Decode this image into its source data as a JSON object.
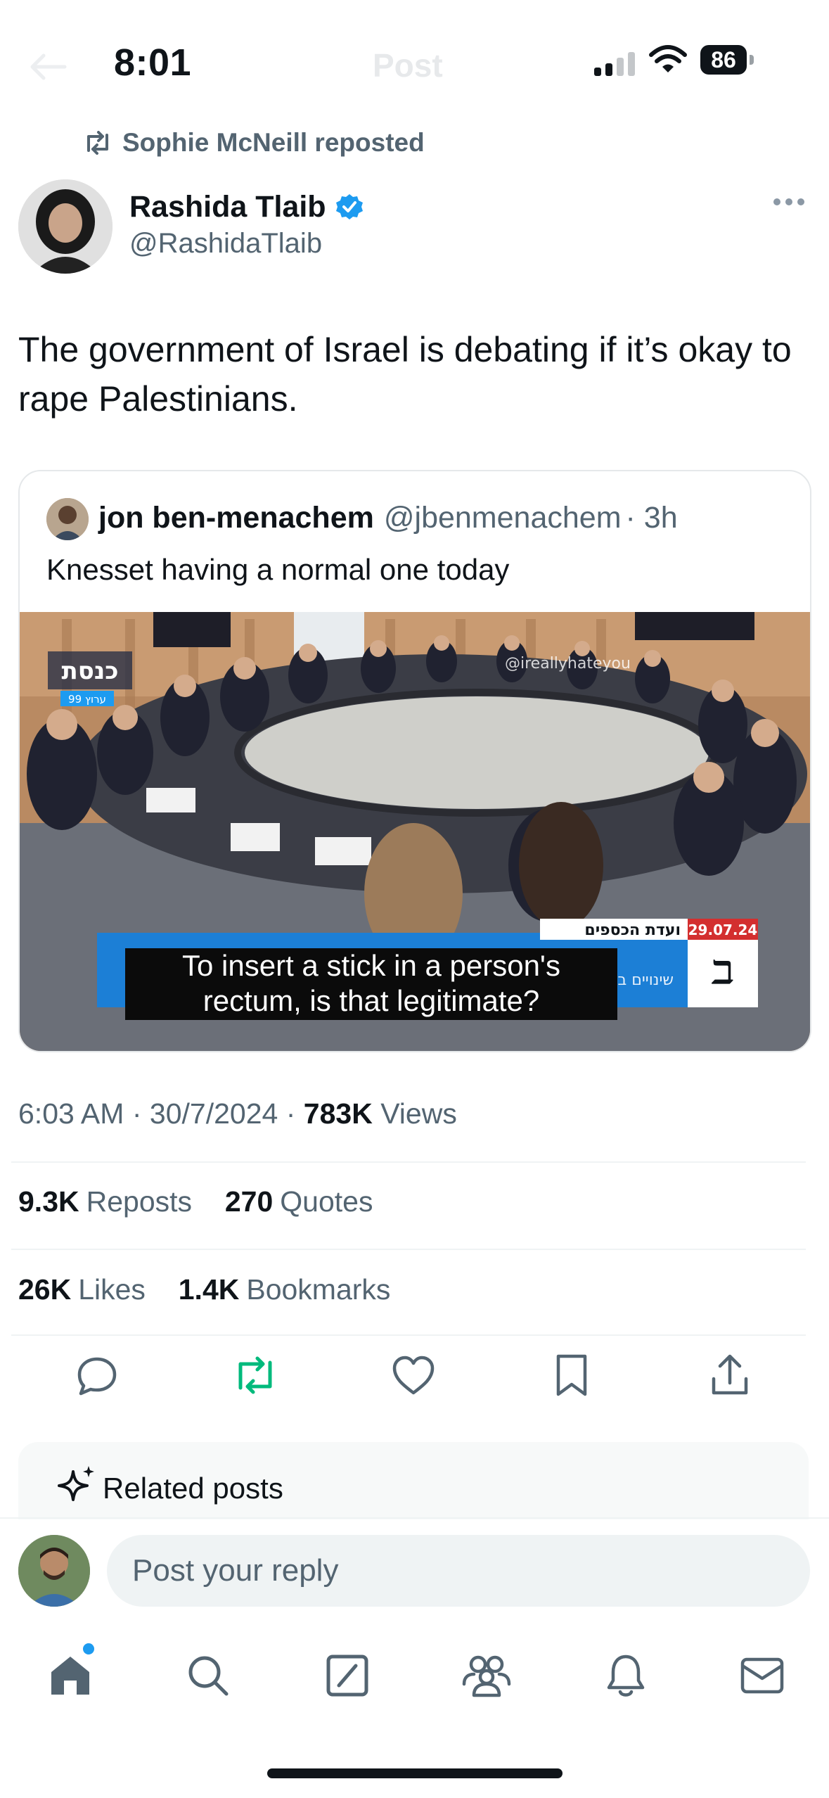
{
  "status_bar": {
    "time": "8:01",
    "battery": "86"
  },
  "header": {
    "title": "Post"
  },
  "repost": {
    "label": "Sophie McNeill reposted"
  },
  "author": {
    "name": "Rashida Tlaib",
    "handle": "@RashidaTlaib",
    "verified": true
  },
  "tweet": {
    "text": "The government of Israel is debating if it’s okay to rape Palestinians."
  },
  "quote": {
    "name": "jon ben-menachem",
    "handle": "@jbenmenachem",
    "time": "· 3h",
    "text": "Knesset having a normal one today",
    "video": {
      "logo": "כנסת",
      "channel": "ערוץ 99",
      "watermark": "@ireallyhateyou",
      "caption_line1": "To insert a stick in a person's",
      "caption_line2": "rectum, is that legitimate?",
      "lower_third": "ועדת הכספים",
      "lower_third_sub": "שינויים בתקציב לשנת 2024",
      "date": "29.07.24"
    }
  },
  "meta": {
    "time": "6:03 AM",
    "sep1": "·",
    "date": "30/7/2024",
    "sep2": "·",
    "views_count": "783K",
    "views_label": "Views"
  },
  "stats": {
    "reposts_count": "9.3K",
    "reposts_label": "Reposts",
    "quotes_count": "270",
    "quotes_label": "Quotes",
    "likes_count": "26K",
    "likes_label": "Likes",
    "bookmarks_count": "1.4K",
    "bookmarks_label": "Bookmarks"
  },
  "actions": [
    "reply-icon",
    "repost-icon",
    "like-icon",
    "bookmark-icon",
    "share-icon"
  ],
  "colors": {
    "accent": "#1d9bf0",
    "repost_green": "#00ba7c",
    "muted": "#536471"
  },
  "related": {
    "label": "Related posts"
  },
  "reply": {
    "placeholder": "Post your reply"
  },
  "tabbar": [
    "home-icon",
    "search-icon",
    "grok-icon",
    "communities-icon",
    "notifications-icon",
    "messages-icon"
  ]
}
